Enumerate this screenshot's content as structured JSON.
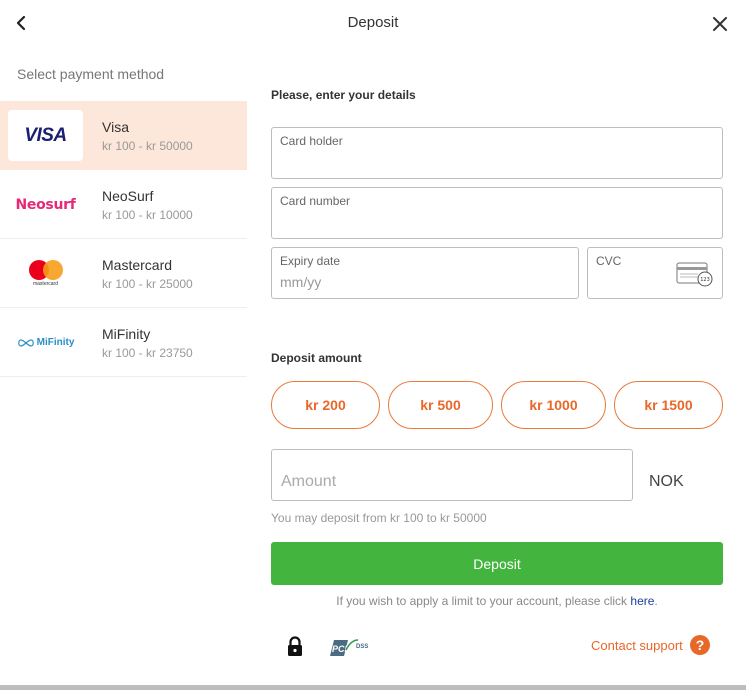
{
  "header": {
    "title": "Deposit",
    "back_icon": "chevron-left-icon",
    "close_icon": "close-icon"
  },
  "sidebar": {
    "heading": "Select payment method",
    "methods": [
      {
        "name": "Visa",
        "range": "kr 100 - kr 50000",
        "logo_text": "VISA",
        "selected": true
      },
      {
        "name": "NeoSurf",
        "range": "kr 100 - kr 10000",
        "logo_text": "Neosurf",
        "selected": false
      },
      {
        "name": "Mastercard",
        "range": "kr 100 - kr 25000",
        "logo_text": "mastercard",
        "selected": false
      },
      {
        "name": "MiFinity",
        "range": "kr 100 - kr 23750",
        "logo_text": "MiFinity",
        "selected": false
      }
    ]
  },
  "form": {
    "details_label": "Please, enter your details",
    "card_holder_label": "Card holder",
    "card_number_label": "Card number",
    "expiry_label": "Expiry date",
    "expiry_placeholder": "mm/yy",
    "cvc_label": "CVC",
    "cvc_icon_text": "123",
    "deposit_amount_label": "Deposit amount",
    "amount_options": [
      "kr 200",
      "kr 500",
      "kr 1000",
      "kr 1500"
    ],
    "amount_placeholder": "Amount",
    "currency": "NOK",
    "hint": "You may deposit from kr 100 to kr 50000",
    "submit_label": "Deposit",
    "limit_text": "If you wish to apply a limit to your account, please click",
    "limit_link": "here",
    "limit_suffix": "."
  },
  "footer": {
    "pci_text": "PCI",
    "pci_dss_text": "DSS",
    "support_label": "Contact support",
    "help_symbol": "?"
  },
  "colors": {
    "accent": "#e8682a",
    "selected_bg": "#fde7da",
    "deposit_green": "#43b53f",
    "link_blue": "#1a3e9e"
  }
}
